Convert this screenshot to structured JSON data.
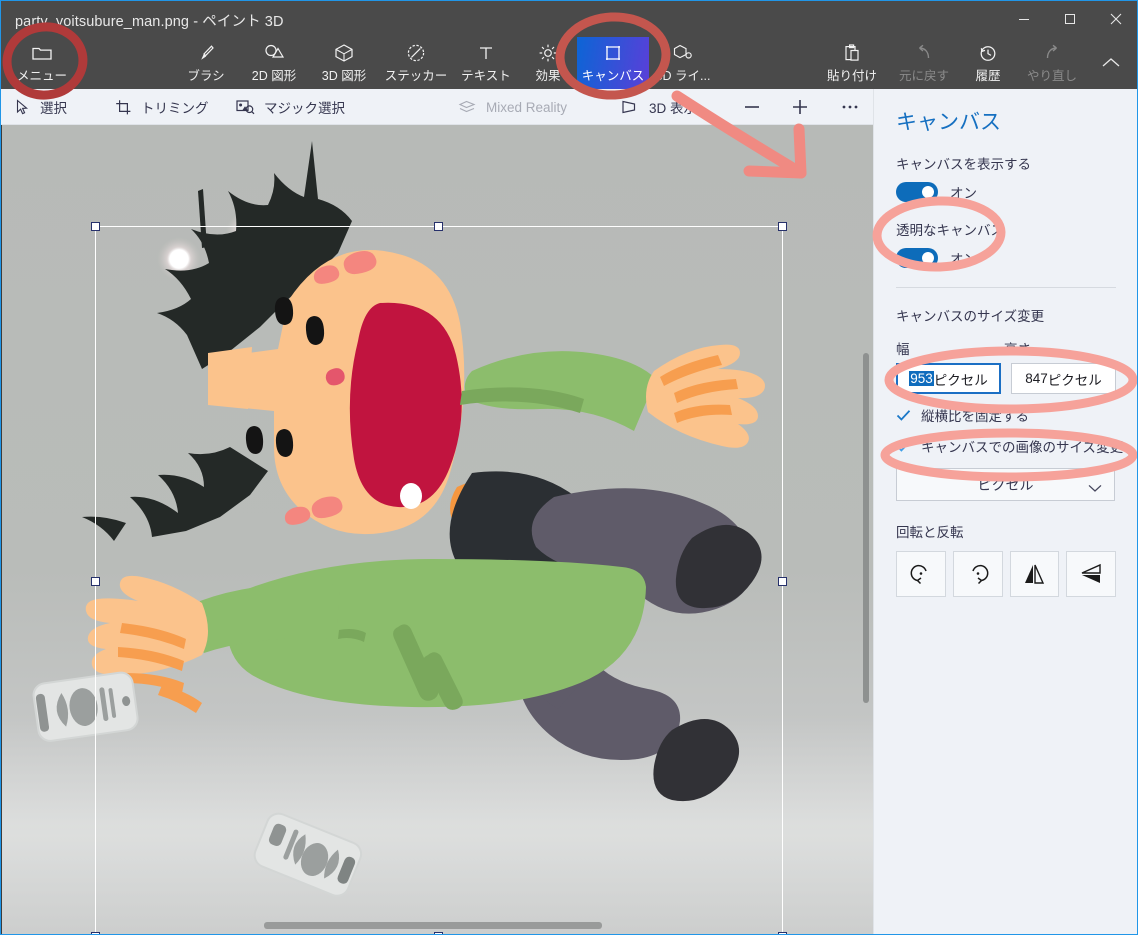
{
  "window": {
    "title": "party_yoitsubure_man.png - ペイント 3D",
    "minimize_label": "最小化",
    "maximize_label": "最大化",
    "close_label": "閉じる"
  },
  "ribbon": {
    "items": [
      {
        "label": "メニュー",
        "icon": "menu-folder-icon",
        "state": "normal"
      },
      {
        "label": "ブラシ",
        "icon": "brush-icon",
        "state": "normal"
      },
      {
        "label": "2D 図形",
        "icon": "shapes-2d-icon",
        "state": "normal"
      },
      {
        "label": "3D 図形",
        "icon": "shapes-3d-icon",
        "state": "normal"
      },
      {
        "label": "ステッカー",
        "icon": "sticker-icon",
        "state": "normal"
      },
      {
        "label": "テキスト",
        "icon": "text-icon",
        "state": "normal"
      },
      {
        "label": "効果",
        "icon": "effects-icon",
        "state": "normal"
      },
      {
        "label": "キャンバス",
        "icon": "canvas-icon",
        "state": "active"
      },
      {
        "label": "3D ライ...",
        "icon": "3d-library-icon",
        "state": "normal"
      },
      {
        "label": "貼り付け",
        "icon": "paste-icon",
        "state": "normal"
      },
      {
        "label": "元に戻す",
        "icon": "undo-icon",
        "state": "disabled"
      },
      {
        "label": "履歴",
        "icon": "history-icon",
        "state": "normal"
      },
      {
        "label": "やり直し",
        "icon": "redo-icon",
        "state": "disabled"
      },
      {
        "label": "",
        "icon": "collapse-chevron-icon",
        "state": "normal"
      }
    ]
  },
  "subbar": {
    "items": [
      {
        "label": "選択",
        "icon": "cursor-select-icon",
        "state": "normal"
      },
      {
        "label": "トリミング",
        "icon": "crop-icon",
        "state": "normal"
      },
      {
        "label": "マジック選択",
        "icon": "magic-select-icon",
        "state": "normal"
      },
      {
        "label": "Mixed Reality",
        "icon": "mixed-reality-icon",
        "state": "disabled"
      },
      {
        "label": "3D 表示",
        "icon": "view-3d-icon",
        "state": "normal"
      },
      {
        "label": "",
        "icon": "zoom-out-icon",
        "state": "normal"
      },
      {
        "label": "",
        "icon": "zoom-in-icon",
        "state": "normal"
      },
      {
        "label": "",
        "icon": "more-ellipsis-icon",
        "state": "normal"
      }
    ]
  },
  "panel": {
    "title": "キャンバス",
    "show_canvas": {
      "label": "キャンバスを表示する",
      "toggle_state": "オン"
    },
    "transparent_canvas": {
      "label": "透明なキャンバス",
      "toggle_state": "オン"
    },
    "resize_heading": "キャンバスのサイズ変更",
    "width_label": "幅",
    "height_label": "高さ",
    "width_value": "953",
    "width_unit": "ピクセル",
    "height_value": "847",
    "height_unit": "ピクセル",
    "lock_aspect": {
      "label": "縦横比を固定する",
      "checked": true
    },
    "resize_image_with_canvas": {
      "label": "キャンバスでの画像のサイズ変更",
      "checked": true
    },
    "unit_select": {
      "value": "ピクセル"
    },
    "rotate_heading": "回転と反転",
    "rotate_buttons": [
      {
        "name": "rotate-left",
        "icon": "rotate-left-icon"
      },
      {
        "name": "rotate-right",
        "icon": "rotate-right-icon"
      },
      {
        "name": "flip-horizontal",
        "icon": "flip-horizontal-icon"
      },
      {
        "name": "flip-vertical",
        "icon": "flip-vertical-icon"
      }
    ]
  },
  "colors": {
    "accent_blue": "#0d6cba",
    "panel_bg": "#eff2f7",
    "ribbon_bg": "#4a4a4a",
    "annotation_red": "#f08a82",
    "annotation_dark_red": "#b03a3a",
    "canvas_bg": "#b8bbb8"
  },
  "artwork": {
    "description": "酔いつぶれた男性のイラスト",
    "skin": "#fbc38c",
    "shirt": "#8cbd6c",
    "pants": "#5f5b69",
    "shoes": "#313136",
    "hair": "#232826",
    "mouth": "#c1143f",
    "can_body": "#e3e5e4",
    "bubble_count": 3,
    "can_count": 2
  },
  "annotations": [
    {
      "name": "menu-circle",
      "shape": "ellipse",
      "color": "#b03a3a"
    },
    {
      "name": "canvas-tab-circle",
      "shape": "ellipse",
      "color": "#c0504a"
    },
    {
      "name": "pointer-arrow",
      "shape": "arrow",
      "color": "#f08a82"
    },
    {
      "name": "transparent-canvas-circle",
      "shape": "ellipse",
      "color": "#f6a29a"
    },
    {
      "name": "size-fields-circle",
      "shape": "ellipse",
      "color": "#f6a29a"
    },
    {
      "name": "resize-image-circle",
      "shape": "ellipse",
      "color": "#f6a29a"
    }
  ]
}
